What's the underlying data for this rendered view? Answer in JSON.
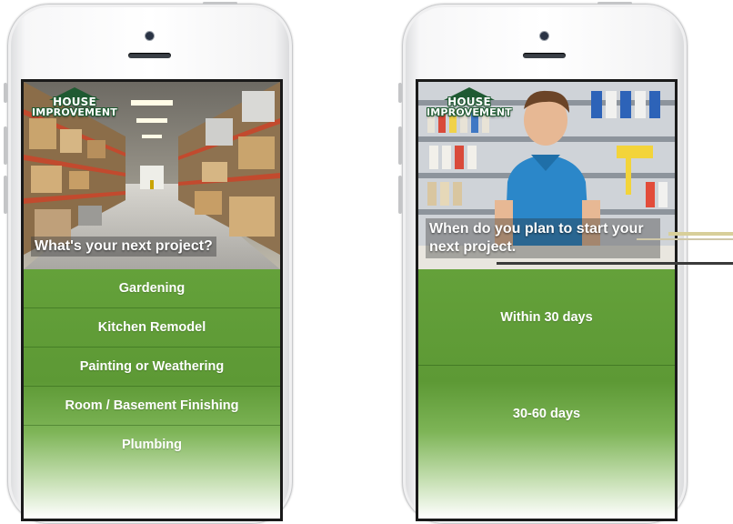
{
  "logo": {
    "line1": "HOUSE",
    "line2": "IMPROVEMENT"
  },
  "left_screen": {
    "hero_caption": "What's your next project?",
    "projects": [
      {
        "label": "Gardening"
      },
      {
        "label": "Kitchen Remodel"
      },
      {
        "label": "Painting or Weathering"
      },
      {
        "label": "Room / Basement Finishing"
      },
      {
        "label": "Plumbing"
      }
    ]
  },
  "right_screen": {
    "hero_caption": "When do you plan to start your next project.",
    "timing_options": [
      {
        "label": "Within 30 days"
      },
      {
        "label": "30-60 days"
      }
    ]
  },
  "colors": {
    "menu_green": "#5d9935",
    "logo_green": "#1f5a32",
    "phone_body": "#f5f5f6"
  }
}
